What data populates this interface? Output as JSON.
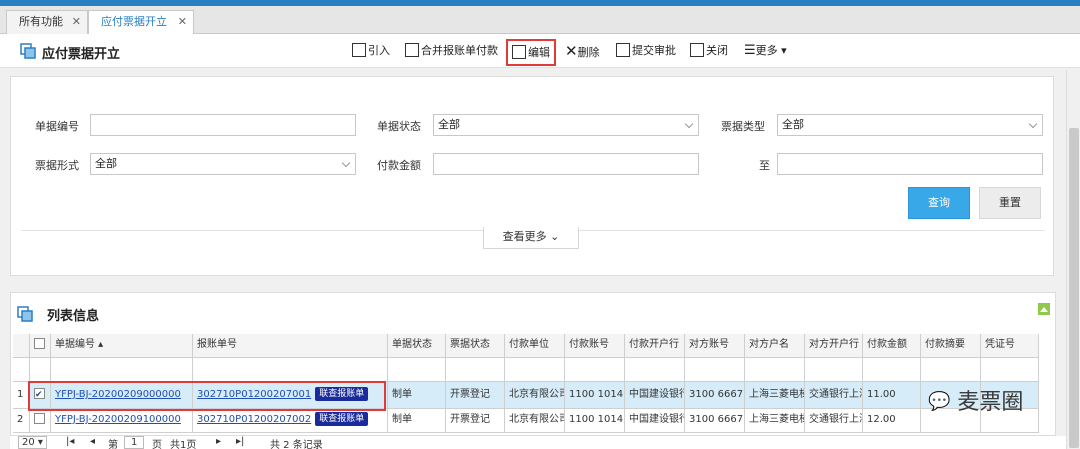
{
  "tabs": [
    {
      "label": "所有功能",
      "active": false
    },
    {
      "label": "应付票据开立",
      "active": true
    }
  ],
  "header": {
    "title": "应付票据开立",
    "toolbar": {
      "import": "引入",
      "merge_pay": "合并报账单付款",
      "edit": "编辑",
      "delete": "删除",
      "submit": "提交审批",
      "close": "关闭",
      "more": "更多"
    }
  },
  "filters": {
    "bill_no_label": "单据编号",
    "bill_no_value": "",
    "bill_status_label": "单据状态",
    "bill_status_value": "全部",
    "note_type_label": "票据类型",
    "note_type_value": "全部",
    "note_form_label": "票据形式",
    "note_form_value": "全部",
    "amount_label": "付款金额",
    "amount_from": "",
    "to_label": "至",
    "amount_to": "",
    "query": "查询",
    "reset": "重置",
    "view_more": "查看更多"
  },
  "list": {
    "title": "列表信息",
    "columns": [
      "单据编号",
      "报账单号",
      "单据状态",
      "票据状态",
      "付款单位",
      "付款账号",
      "付款开户行",
      "对方账号",
      "对方户名",
      "对方开户行",
      "付款金额",
      "付款摘要",
      "凭证号"
    ],
    "rows": [
      {
        "index": "1",
        "checked": true,
        "bill_no": "YFPJ-BJ-20200209000000",
        "claim_no": "302710P01200207001",
        "tag": "联查报账单",
        "bill_status": "制单",
        "note_status": "开票登记",
        "payer": "北京有限公司",
        "payer_acct": "1100 1014",
        "payer_bank": "中国建设银行",
        "peer_acct": "3100 6667",
        "peer_name": "上海三菱电梯",
        "peer_bank": "交通银行上海",
        "amount": "11.00",
        "summary": "",
        "voucher": ""
      },
      {
        "index": "2",
        "checked": false,
        "bill_no": "YFPJ-BJ-20200209100000",
        "claim_no": "302710P01200207002",
        "tag": "联查报账单",
        "bill_status": "制单",
        "note_status": "开票登记",
        "payer": "北京有限公司",
        "payer_acct": "1100 1014",
        "payer_bank": "中国建设银行",
        "peer_acct": "3100 6667",
        "peer_name": "上海三菱电梯",
        "peer_bank": "交通银行上海",
        "amount": "12.00",
        "summary": "",
        "voucher": ""
      }
    ]
  },
  "pager": {
    "page_size": "20",
    "page_prefix": "第",
    "page": "1",
    "page_suffix": "页",
    "total_pages": "共1页",
    "total_records": "共 2 条记录"
  },
  "watermark": "麦票圈",
  "colors": {
    "accent": "#2a7fc1",
    "highlight": "#e03a3a",
    "primary_button": "#39a8e8",
    "tag": "#1a2b9c",
    "selected_row": "#d6ecf8"
  }
}
